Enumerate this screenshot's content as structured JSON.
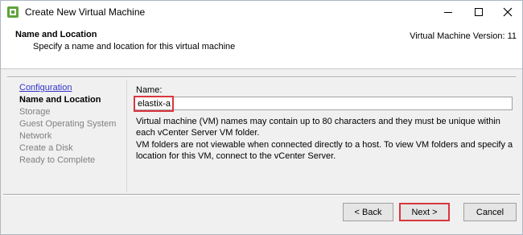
{
  "window": {
    "title": "Create New Virtual Machine",
    "icon": "vsphere-icon"
  },
  "header": {
    "title": "Name and Location",
    "subtitle": "Specify a name and location for this virtual machine",
    "version": "Virtual Machine Version: 11"
  },
  "nav": {
    "items": [
      {
        "label": "Configuration",
        "state": "link"
      },
      {
        "label": "Name and Location",
        "state": "current"
      },
      {
        "label": "Storage",
        "state": "disabled"
      },
      {
        "label": "Guest Operating System",
        "state": "disabled"
      },
      {
        "label": "Network",
        "state": "disabled"
      },
      {
        "label": "Create a Disk",
        "state": "disabled"
      },
      {
        "label": "Ready to Complete",
        "state": "disabled"
      }
    ]
  },
  "form": {
    "name_label": "Name:",
    "name_value": "elastix-a",
    "help_1": "Virtual machine (VM) names may contain up to 80 characters and they must be unique within each vCenter Server VM folder.",
    "help_2": "VM folders are not viewable when connected directly to a host. To view VM folders and specify a location for this VM, connect to the vCenter Server."
  },
  "buttons": {
    "back": "< Back",
    "next": "Next >",
    "cancel": "Cancel"
  },
  "colors": {
    "highlight": "#d9363e",
    "link": "#3333cc",
    "disabled": "#808080"
  }
}
